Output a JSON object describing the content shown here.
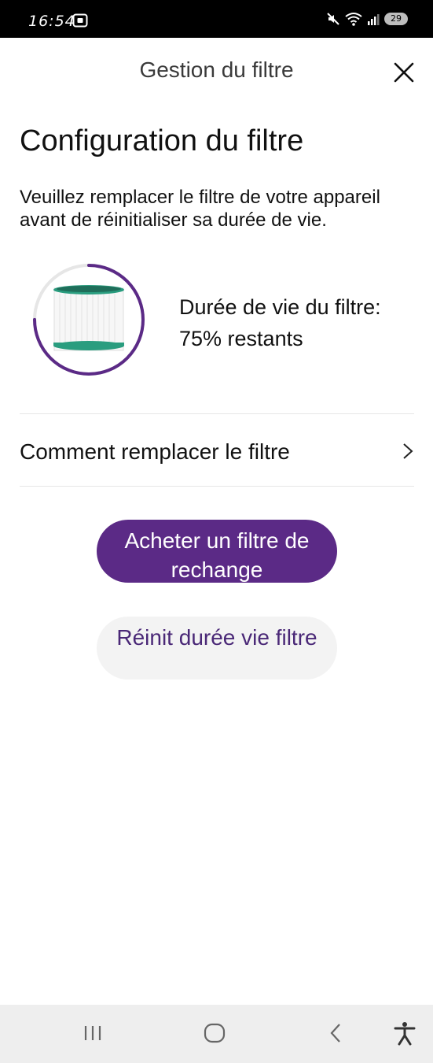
{
  "status_bar": {
    "time": "16:54",
    "battery": "29",
    "icons": [
      "screen-record-icon",
      "mute-icon",
      "wifi-icon",
      "signal-icon",
      "battery-icon"
    ]
  },
  "header": {
    "title": "Gestion du filtre",
    "close_icon": "close-icon"
  },
  "main": {
    "heading": "Configuration du filtre",
    "description": "Veuillez remplacer le filtre de votre appareil avant de réinitialiser sa durée de vie.",
    "filter_life": {
      "label": "Durée de vie du filtre:",
      "remaining": "75% restants",
      "percent": 75
    },
    "howto_label": "Comment remplacer le filtre",
    "buy_button": "Acheter un filtre de rechange",
    "reset_button": "Réinit durée vie filtre"
  },
  "colors": {
    "accent": "#5b2a86",
    "gauge_track": "#e6e6e6",
    "filter_green": "#2a9d7f"
  },
  "nav_bar": {
    "icons": [
      "recent-apps-icon",
      "home-icon",
      "back-icon",
      "accessibility-icon"
    ]
  }
}
